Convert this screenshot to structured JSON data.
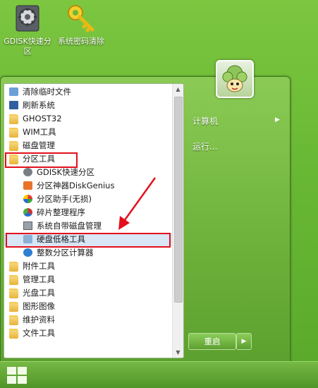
{
  "desktop_icons": [
    {
      "icon": "gear-disk-icon",
      "label": "GDISK快速分区"
    },
    {
      "icon": "key-icon",
      "label": "系统密码清除"
    }
  ],
  "start_menu": {
    "programs": [
      {
        "label": "清除临时文件",
        "icon": "clean-icon",
        "level": 0
      },
      {
        "label": "刷新系统",
        "icon": "refresh-icon",
        "level": 0
      },
      {
        "label": "GHOST32",
        "icon": "folder-icon",
        "level": 0
      },
      {
        "label": "WIM工具",
        "icon": "folder-icon",
        "level": 0
      },
      {
        "label": "磁盘管理",
        "icon": "folder-icon",
        "level": 0
      },
      {
        "label": "分区工具",
        "icon": "folder-icon",
        "level": 0,
        "highlighted": true
      },
      {
        "label": "GDISK快速分区",
        "icon": "gdisk-icon",
        "level": 1
      },
      {
        "label": "分区神器DiskGenius",
        "icon": "diskgenius-icon",
        "level": 1
      },
      {
        "label": "分区助手(无损)",
        "icon": "partition-assistant-icon",
        "level": 1
      },
      {
        "label": "碎片整理程序",
        "icon": "defrag-icon",
        "level": 1
      },
      {
        "label": "系统自带磁盘管理",
        "icon": "disk-management-icon",
        "level": 1
      },
      {
        "label": "硬盘低格工具",
        "icon": "low-format-icon",
        "level": 1,
        "highlighted": true,
        "selected": true
      },
      {
        "label": "整数分区计算器",
        "icon": "calculator-icon",
        "level": 1
      },
      {
        "label": "附件工具",
        "icon": "folder-icon",
        "level": 0
      },
      {
        "label": "管理工具",
        "icon": "folder-icon",
        "level": 0
      },
      {
        "label": "光盘工具",
        "icon": "folder-icon",
        "level": 0
      },
      {
        "label": "图形图像",
        "icon": "folder-icon",
        "level": 0
      },
      {
        "label": "维护资料",
        "icon": "folder-icon",
        "level": 0
      },
      {
        "label": "文件工具",
        "icon": "folder-icon",
        "level": 0
      }
    ],
    "right_pane": {
      "computer_label": "计算机",
      "run_label": "运行...",
      "restart_label": "重启"
    }
  },
  "colors": {
    "highlight_box": "#e3101c",
    "annotation_arrow": "#e3101c",
    "desktop_green": "#6ab935"
  }
}
